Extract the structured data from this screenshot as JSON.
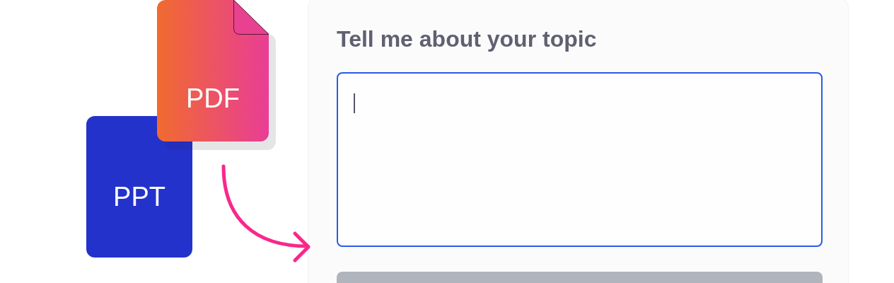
{
  "illustration": {
    "files": [
      {
        "kind": "ppt",
        "label": "PPT"
      },
      {
        "kind": "pdf",
        "label": "PDF"
      }
    ]
  },
  "form": {
    "heading": "Tell me about your topic",
    "topic_field": {
      "focused": true
    },
    "submit_button": {
      "disabled": true
    }
  }
}
